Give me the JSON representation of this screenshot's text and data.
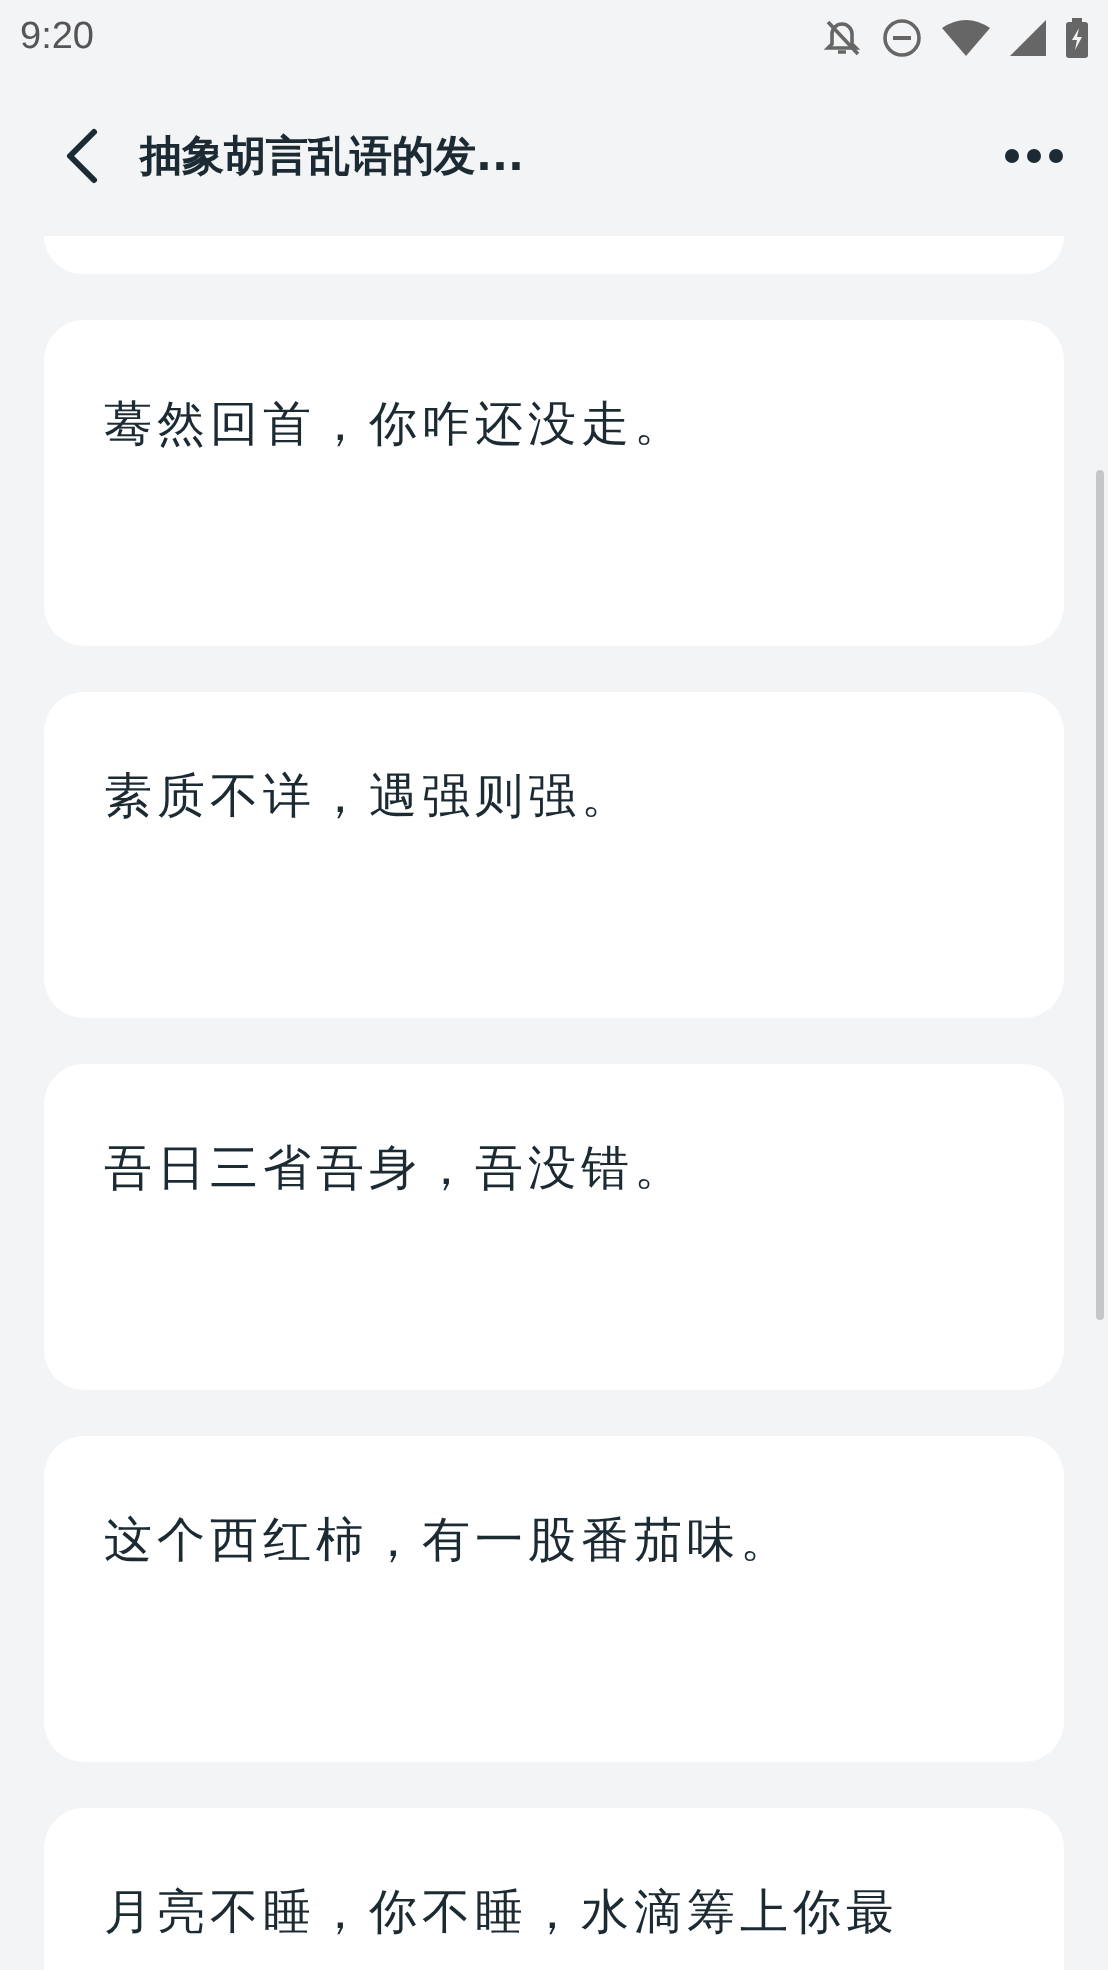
{
  "status_bar": {
    "time": "9:20"
  },
  "header": {
    "title": "抽象胡言乱语的发..."
  },
  "cards": [
    {
      "text": "蓦然回首，你咋还没走。"
    },
    {
      "text": "素质不详，遇强则强。"
    },
    {
      "text": "吾日三省吾身，吾没错。"
    },
    {
      "text": "这个西红柿，有一股番茄味。"
    },
    {
      "text": "月亮不睡，你不睡，水滴筹上你最"
    }
  ]
}
